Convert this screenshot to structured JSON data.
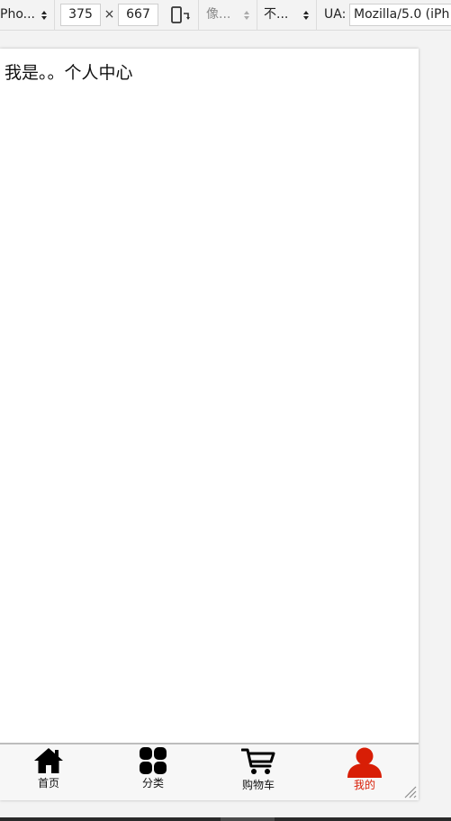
{
  "toolbar": {
    "device": "Pho...",
    "width": "375",
    "times": "×",
    "height": "667",
    "dpr": "像...",
    "throttle": "不...",
    "ua_label": "UA:",
    "ua_value": "Mozilla/5.0 (iPh"
  },
  "page": {
    "content_text": "我是。。个人中心"
  },
  "tabbar": {
    "items": [
      {
        "label": "首页",
        "icon": "home-icon",
        "active": false
      },
      {
        "label": "分类",
        "icon": "category-grid-icon",
        "active": false
      },
      {
        "label": "购物车",
        "icon": "shopping-cart-icon",
        "active": false
      },
      {
        "label": "我的",
        "icon": "user-icon",
        "active": true
      }
    ],
    "active_color": "#d81e06",
    "inactive_color": "#000000"
  }
}
